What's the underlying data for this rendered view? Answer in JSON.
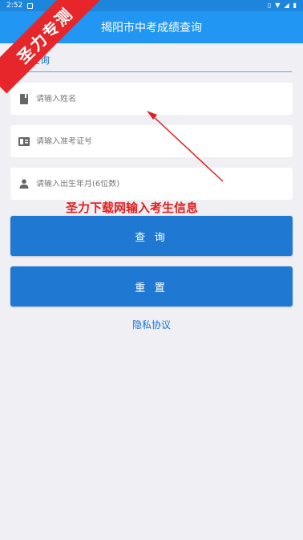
{
  "status_bar": {
    "time": "2:52",
    "icons": [
      "vibrate-icon",
      "wifi-icon",
      "signal-icon",
      "battery-icon"
    ]
  },
  "app_bar": {
    "title": "揭阳市中考成绩查询"
  },
  "watermark": {
    "text": "圣力专测"
  },
  "section": {
    "title": "成绩查询"
  },
  "form": {
    "name_placeholder": "请输入姓名",
    "exam_id_placeholder": "请输入准考证号",
    "birth_placeholder": "请输入出生年月(6位数)"
  },
  "annotation": {
    "text": "圣力下载网输入考生信息"
  },
  "buttons": {
    "query": "查 询",
    "reset": "重 置"
  },
  "privacy": {
    "label": "隐私协议"
  },
  "colors": {
    "primary": "#2196f3",
    "button": "#1f79d3",
    "watermark": "#e6262a",
    "annotation": "#e02020"
  }
}
